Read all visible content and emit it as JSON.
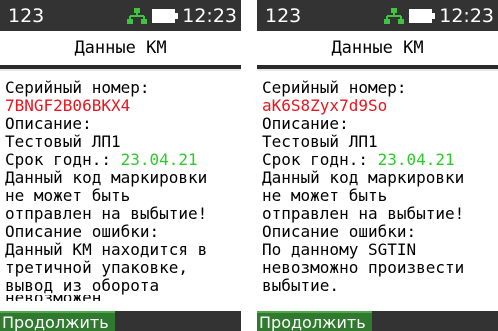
{
  "colors": {
    "status_bar_bg": "#333333",
    "icon_green": "#3ec43e",
    "serial_red": "#e8161e",
    "date_green": "#2ccb2c",
    "softkey_bg": "#2f7a2f"
  },
  "left": {
    "status": {
      "label": "123",
      "time": "12:23",
      "net_icon": "network-icon",
      "battery_icon": "battery-icon"
    },
    "title": "Данные КМ",
    "lines": {
      "serial_label": "Серийный номер:",
      "serial_value": "7BNGF2B06BKX4",
      "desc_label": "Описание:",
      "desc_value": "Тестовый ЛП1",
      "exp_label": "Срок годн.: ",
      "exp_value": "23.04.21",
      "msg1": "Данный код маркировки",
      "msg2": "не может быть",
      "msg3": "отправлен на выбытие!",
      "err_label": "Описание ошибки:",
      "err1": "Данный КМ находится в",
      "err2": "третичной упаковке,",
      "err3": "вывод из оборота",
      "err4": "невозможен"
    },
    "softkey": "Продолжить"
  },
  "right": {
    "status": {
      "label": "123",
      "time": "12:23",
      "net_icon": "network-icon",
      "battery_icon": "battery-icon"
    },
    "title": "Данные КМ",
    "lines": {
      "serial_label": "Серийный номер:",
      "serial_value": "aK6S8Zyx7d9So",
      "desc_label": "Описание:",
      "desc_value": "Тестовый ЛП1",
      "exp_label": "Срок годн.: ",
      "exp_value": "23.04.21",
      "msg1": "Данный код маркировки",
      "msg2": "не может быть",
      "msg3": "отправлен на выбытие!",
      "err_label": "Описание ошибки:",
      "err1": "По данному SGTIN",
      "err2": "невозможно произвести",
      "err3": "выбытие."
    },
    "softkey": "Продолжить"
  }
}
